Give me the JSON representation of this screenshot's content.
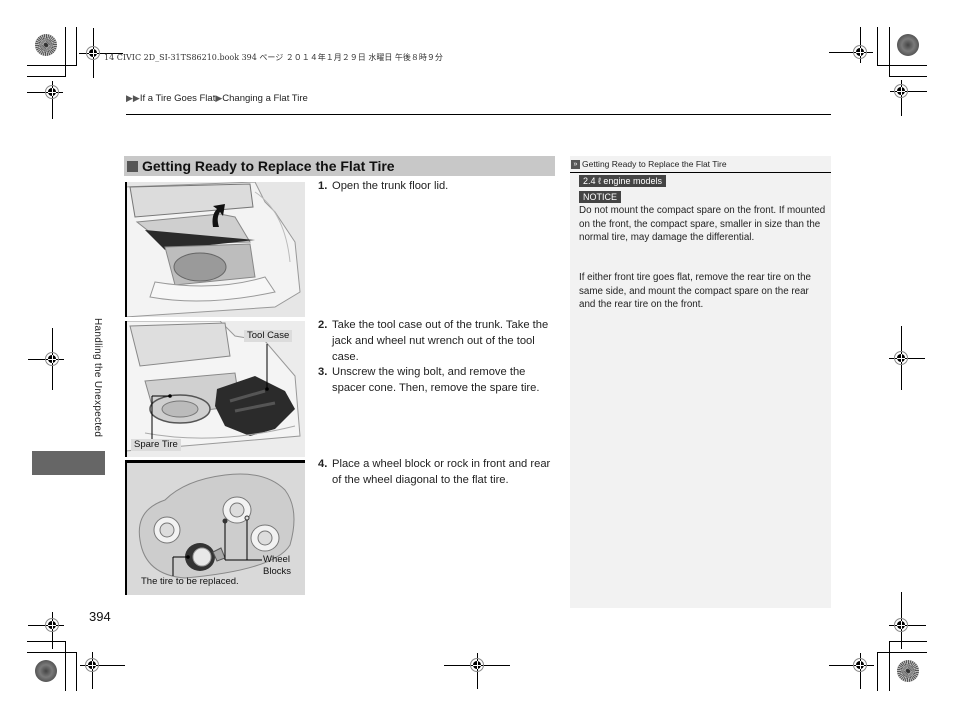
{
  "print_info": "14 CIVIC 2D_SI-31TS86210.book  394 ページ  ２０１４年１月２９日  水曜日  午後８時９分",
  "breadcrumb": {
    "marker": "▶▶",
    "items": [
      "If a Tire Goes Flat",
      "Changing a Flat Tire"
    ],
    "separator": "▶"
  },
  "side_tab": {
    "label": "Handling the Unexpected",
    "accent_color": "#666666"
  },
  "section": {
    "title": "Getting Ready to Replace the Flat Tire"
  },
  "steps": [
    {
      "number": "1.",
      "text": "Open the trunk floor lid."
    },
    {
      "number": "2.",
      "text": "Take the tool case out of the trunk. Take the jack and wheel nut wrench out of the tool case."
    },
    {
      "number": "3.",
      "text": "Unscrew the wing bolt, and remove the spacer cone. Then, remove the spare tire."
    },
    {
      "number": "4.",
      "text": "Place a wheel block or rock in front and rear of the wheel diagonal to the flat tire."
    }
  ],
  "figures": {
    "fig1": {
      "description": "open-trunk-floor-lid-illustration"
    },
    "fig2": {
      "description": "trunk-tool-case-spare-tire-illustration",
      "labels": {
        "tool_case": "Tool Case",
        "spare_tire": "Spare Tire"
      }
    },
    "fig3": {
      "description": "wheel-blocks-diagram",
      "labels": {
        "wheel_blocks_line1": "Wheel",
        "wheel_blocks_line2": "Blocks",
        "tire_replaced": "The tire to be replaced."
      }
    }
  },
  "sidebar_note": {
    "icon": "double-chevron-icon",
    "header": "Getting Ready to Replace the Flat Tire",
    "tag_engine": "2.4 ℓ engine models",
    "tag_notice": "NOTICE",
    "paragraph1": "Do not mount the compact spare on the front. If mounted on the front, the compact spare, smaller in size than the normal tire, may damage the differential.",
    "paragraph2": "If either front tire goes flat, remove the rear tire on the same side, and mount the compact spare on the rear and the rear tire on the front."
  },
  "page_number": "394"
}
